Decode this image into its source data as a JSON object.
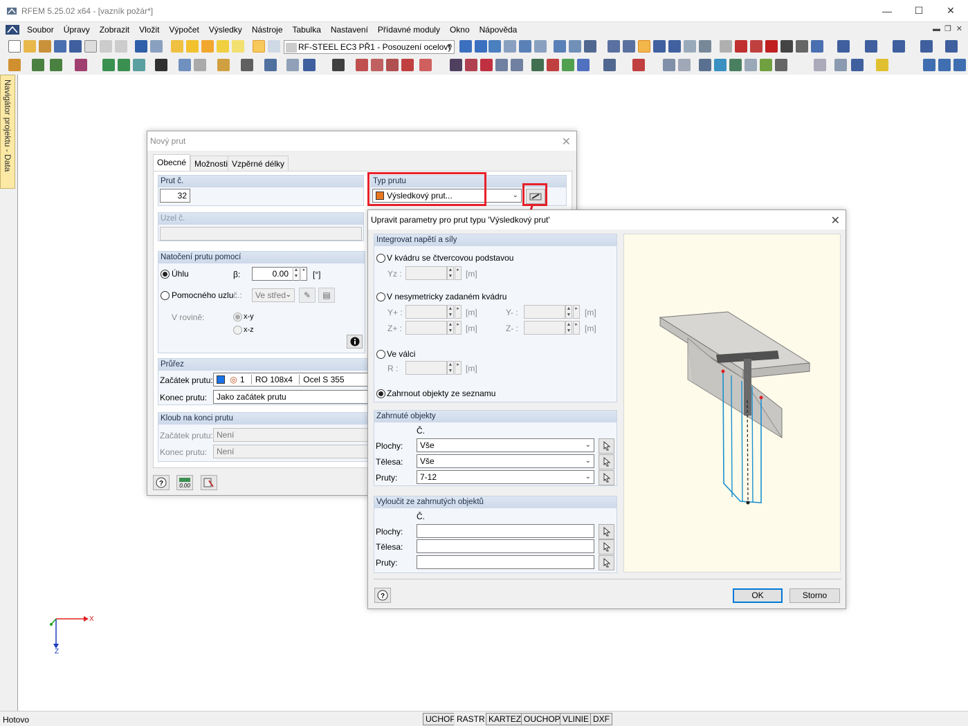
{
  "window": {
    "title": "RFEM 5.25.02 x64 - [vazník požár*]"
  },
  "menu": [
    "Soubor",
    "Úpravy",
    "Zobrazit",
    "Vložit",
    "Výpočet",
    "Výsledky",
    "Nástroje",
    "Tabulka",
    "Nastavení",
    "Přídavné moduly",
    "Okno",
    "Nápověda"
  ],
  "toolbar": {
    "module_combo": "RF-STEEL EC3 PŘ1 - Posouzení ocelový"
  },
  "navigator": {
    "label": "Navigátor projektu - Data"
  },
  "axes": {
    "x": "X",
    "z": "Z"
  },
  "status": {
    "ready": "Hotovo",
    "toggles": [
      "UCHOP",
      "RASTR",
      "KARTEZ",
      "OUCHOP",
      "VLINIE",
      "DXF"
    ]
  },
  "member_dialog": {
    "title": "Nový prut",
    "tabs": [
      "Obecné",
      "Možnosti",
      "Vzpěrné délky"
    ],
    "member_no": {
      "header": "Prut č.",
      "value": "32"
    },
    "member_type": {
      "header": "Typ prutu",
      "value": "Výsledkový prut...",
      "color": "#e87722"
    },
    "node_no": {
      "header": "Uzel č."
    },
    "rotation": {
      "header": "Natočení prutu pomocí",
      "angle_label": "Úhlu",
      "beta_label": "β:",
      "beta_value": "0.00",
      "unit": "[°]",
      "helper_label": "Pomocného uzlu",
      "c_label": "č.:",
      "c_value": "Ve střed",
      "plane_label": "V rovině:",
      "xy": "x-y",
      "xz": "x-z"
    },
    "section": {
      "header": "Průřez",
      "start_label": "Začátek prutu:",
      "start_no": "1",
      "start_name": "RO 108x4",
      "start_material": "Ocel S 355",
      "end_label": "Konec prutu:",
      "end_value": "Jako začátek prutu"
    },
    "hinge": {
      "header": "Kloub na konci prutu",
      "start_label": "Začátek prutu:",
      "start_value": "Není",
      "end_label": "Konec prutu:",
      "end_value": "Není"
    }
  },
  "result_dialog": {
    "title": "Upravit parametry pro prut typu 'Výsledkový prut'",
    "integrate": {
      "header": "Integrovat napětí a síly",
      "opt1": "V kvádru se čtvercovou podstavou",
      "yz_label": "Yz :",
      "unit": "[m]",
      "opt2": "V nesymetricky zadaném kvádru",
      "yplus": "Y+ :",
      "yminus": "Y- :",
      "zplus": "Z+ :",
      "zminus": "Z- :",
      "opt3": "Ve válci",
      "r_label": "R :",
      "opt4": "Zahrnout objekty ze seznamu"
    },
    "included": {
      "header": "Zahrnuté objekty",
      "col": "Č.",
      "surfaces_label": "Plochy:",
      "surfaces_value": "Vše",
      "solids_label": "Tělesa:",
      "solids_value": "Vše",
      "members_label": "Pruty:",
      "members_value": "7-12"
    },
    "excluded": {
      "header": "Vyloučit ze zahrnutých objektů",
      "col": "Č.",
      "surfaces_label": "Plochy:",
      "solids_label": "Tělesa:",
      "members_label": "Pruty:"
    },
    "ok": "OK",
    "cancel": "Storno"
  }
}
